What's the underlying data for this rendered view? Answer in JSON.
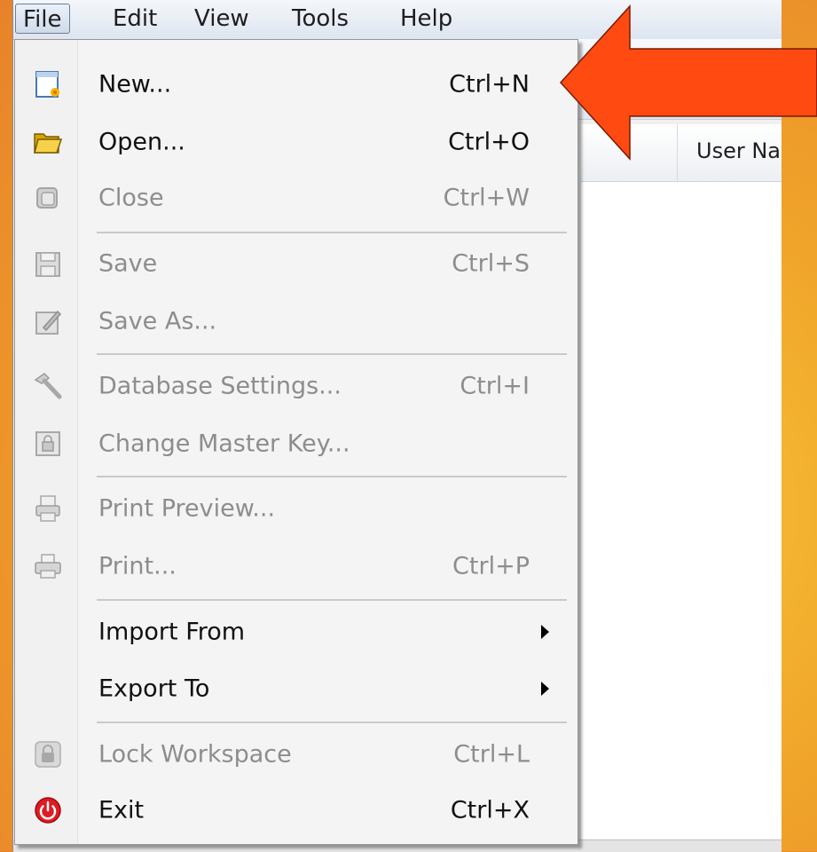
{
  "menubar": {
    "items": [
      "File",
      "Edit",
      "View",
      "Tools",
      "Help"
    ],
    "active": "File"
  },
  "list": {
    "column_header": "User Na"
  },
  "file_menu": {
    "items": [
      {
        "label": "New...",
        "shortcut": "Ctrl+N",
        "enabled": true,
        "icon": "new-document-icon"
      },
      {
        "label": "Open...",
        "shortcut": "Ctrl+O",
        "enabled": true,
        "icon": "folder-open-icon"
      },
      {
        "label": "Close",
        "shortcut": "Ctrl+W",
        "enabled": false,
        "icon": "close-database-icon"
      },
      {
        "label": "Save",
        "shortcut": "Ctrl+S",
        "enabled": false,
        "icon": "floppy-disk-icon"
      },
      {
        "label": "Save As...",
        "shortcut": "",
        "enabled": false,
        "icon": "save-as-icon"
      },
      {
        "label": "Database Settings...",
        "shortcut": "Ctrl+I",
        "enabled": false,
        "icon": "hammer-icon"
      },
      {
        "label": "Change Master Key...",
        "shortcut": "",
        "enabled": false,
        "icon": "master-key-icon"
      },
      {
        "label": "Print Preview...",
        "shortcut": "",
        "enabled": false,
        "icon": "print-preview-icon"
      },
      {
        "label": "Print...",
        "shortcut": "Ctrl+P",
        "enabled": false,
        "icon": "printer-icon"
      },
      {
        "label": "Import From",
        "shortcut": "",
        "enabled": true,
        "icon": "",
        "submenu": true
      },
      {
        "label": "Export To",
        "shortcut": "",
        "enabled": true,
        "icon": "",
        "submenu": true
      },
      {
        "label": "Lock Workspace",
        "shortcut": "Ctrl+L",
        "enabled": false,
        "icon": "padlock-icon"
      },
      {
        "label": "Exit",
        "shortcut": "Ctrl+X",
        "enabled": true,
        "icon": "power-icon"
      }
    ]
  },
  "colors": {
    "annotation_arrow": "#ff4a12",
    "disabled_text": "#8d8d8d",
    "background": "#f0a52a"
  }
}
